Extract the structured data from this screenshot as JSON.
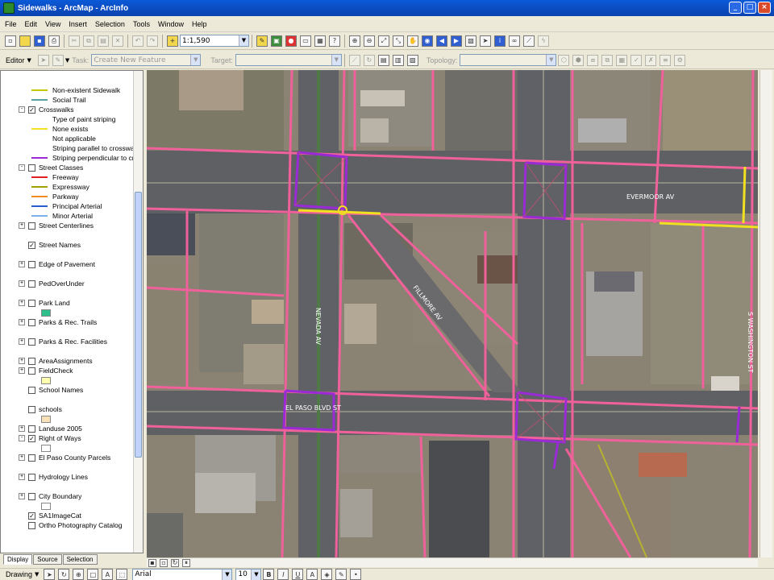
{
  "window": {
    "title": "Sidewalks - ArcMap - ArcInfo"
  },
  "menu": [
    "File",
    "Edit",
    "View",
    "Insert",
    "Selection",
    "Tools",
    "Window",
    "Help"
  ],
  "toolbar": {
    "scale": "1:1,590"
  },
  "editor": {
    "label": "Editor",
    "task_label": "Task:",
    "task_value": "Create New Feature",
    "target_label": "Target:",
    "topology_label": "Topology:"
  },
  "toc": {
    "items": [
      {
        "label": "Non-existent Sidewalk",
        "kind": "legend",
        "symbol": "line",
        "color": "#c8c800"
      },
      {
        "label": "Social Trail",
        "kind": "legend",
        "symbol": "line",
        "color": "#5aa0a0"
      },
      {
        "label": "Crosswalks",
        "kind": "layer",
        "expander": "-",
        "checked": true
      },
      {
        "label": "Type of paint striping",
        "kind": "heading"
      },
      {
        "label": "None exists",
        "kind": "legend",
        "symbol": "line",
        "color": "#f0e020"
      },
      {
        "label": "Not applicable",
        "kind": "legend",
        "symbol": "line",
        "color": "#ffffff"
      },
      {
        "label": "Striping parallel to crosswal",
        "kind": "legend",
        "symbol": "line",
        "color": "#ffffff"
      },
      {
        "label": "Striping perpendicular to cr",
        "kind": "legend",
        "symbol": "line",
        "color": "#9a2ad6"
      },
      {
        "label": "Street Classes",
        "kind": "layer",
        "expander": "-",
        "checked": false
      },
      {
        "label": "Freeway",
        "kind": "legend",
        "symbol": "line",
        "color": "#e02020"
      },
      {
        "label": "Expressway",
        "kind": "legend",
        "symbol": "line",
        "color": "#a0a000"
      },
      {
        "label": "Parkway",
        "kind": "legend",
        "symbol": "line",
        "color": "#f08c20"
      },
      {
        "label": "Principal Arterial",
        "kind": "legend",
        "symbol": "line",
        "color": "#2a5ad0"
      },
      {
        "label": "Minor Arterial",
        "kind": "legend",
        "symbol": "line",
        "color": "#7ab0e8"
      },
      {
        "label": "Street Centerlines",
        "kind": "layer",
        "expander": "+",
        "checked": false
      },
      {
        "label": "Street Names",
        "kind": "layer",
        "expander": "",
        "checked": true
      },
      {
        "label": "Edge of Pavement",
        "kind": "layer",
        "expander": "+",
        "checked": false
      },
      {
        "label": "PedOverUnder",
        "kind": "layer",
        "expander": "+",
        "checked": false
      },
      {
        "label": "Park Land",
        "kind": "layer",
        "expander": "+",
        "checked": false,
        "symbol": "box",
        "color": "#2fbf8a"
      },
      {
        "label": "Parks & Rec. Trails",
        "kind": "layer",
        "expander": "+",
        "checked": false
      },
      {
        "label": "Parks & Rec. Facilities",
        "kind": "layer",
        "expander": "+",
        "checked": false
      },
      {
        "label": "AreaAssignments",
        "kind": "layer",
        "expander": "+",
        "checked": false
      },
      {
        "label": "FieldCheck",
        "kind": "layer",
        "expander": "+",
        "checked": false,
        "symbol": "box",
        "color": "#ffffb0"
      },
      {
        "label": "School Names",
        "kind": "layer",
        "expander": "",
        "checked": false
      },
      {
        "label": "schools",
        "kind": "layer",
        "expander": "",
        "checked": false,
        "symbol": "box",
        "color": "#f8e0b8"
      },
      {
        "label": "Landuse 2005",
        "kind": "layer",
        "expander": "+",
        "checked": false
      },
      {
        "label": "Right of Ways",
        "kind": "layer",
        "expander": "-",
        "checked": true,
        "symbol": "box",
        "color": "#ffffff"
      },
      {
        "label": "El Paso County Parcels",
        "kind": "layer",
        "expander": "+",
        "checked": false
      },
      {
        "label": "Hydrology Lines",
        "kind": "layer",
        "expander": "+",
        "checked": false
      },
      {
        "label": "City Boundary",
        "kind": "layer",
        "expander": "+",
        "checked": false,
        "symbol": "box",
        "color": "#ffffff"
      },
      {
        "label": "SA1ImageCat",
        "kind": "layer",
        "expander": "",
        "checked": true
      },
      {
        "label": "Ortho Photography Catalog",
        "kind": "layer",
        "expander": "",
        "checked": false
      }
    ],
    "tabs": [
      "Display",
      "Source",
      "Selection"
    ]
  },
  "map": {
    "labels": [
      "EVERMOOR AV",
      "NEVADA AV",
      "EL PASO BLVD ST",
      "FILLMORE AV",
      "S WASHINGTON ST"
    ],
    "colors": {
      "right_of_way": "#f0609a",
      "striping_perpendicular": "#9a2ad6",
      "none_exists": "#f0e020"
    }
  },
  "drawing": {
    "label": "Drawing",
    "font": "Arial",
    "size": "10"
  }
}
